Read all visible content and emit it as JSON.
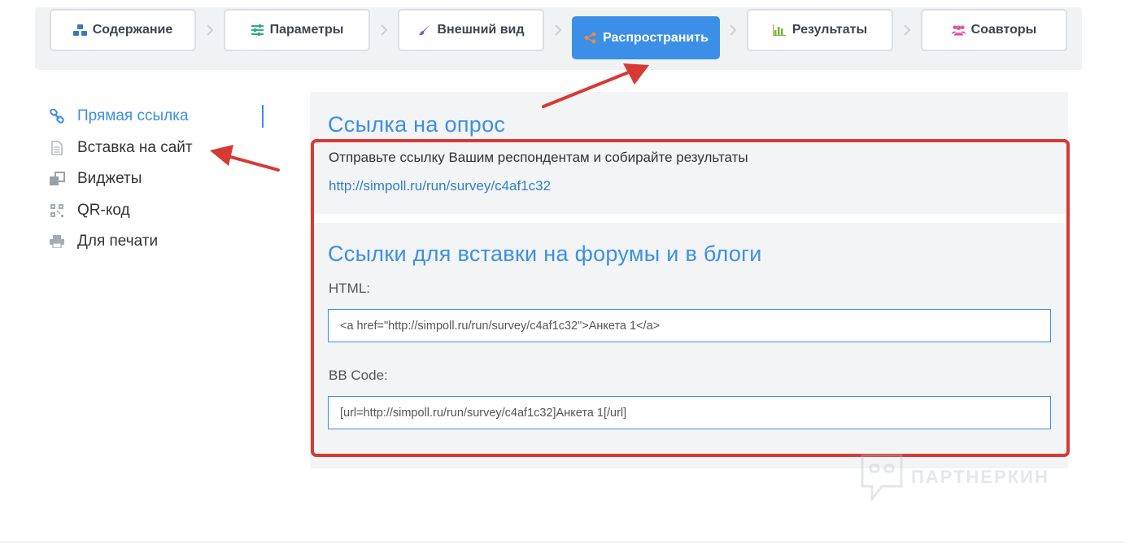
{
  "steps": [
    {
      "label": "Содержание",
      "icon": "cubes-icon"
    },
    {
      "label": "Параметры",
      "icon": "sliders-icon"
    },
    {
      "label": "Внешний вид",
      "icon": "brush-icon"
    },
    {
      "label": "Распространить",
      "icon": "share-icon",
      "active": true
    },
    {
      "label": "Результаты",
      "icon": "bar-chart-icon"
    },
    {
      "label": "Соавторы",
      "icon": "users-icon"
    }
  ],
  "sidebar": {
    "items": [
      {
        "label": "Прямая ссылка",
        "icon": "link-icon",
        "active": true
      },
      {
        "label": "Вставка на сайт",
        "icon": "document-icon"
      },
      {
        "label": "Виджеты",
        "icon": "widgets-icon"
      },
      {
        "label": "QR-код",
        "icon": "qr-code-icon"
      },
      {
        "label": "Для печати",
        "icon": "printer-icon"
      }
    ]
  },
  "main": {
    "survey_link": {
      "title": "Ссылка на опрос",
      "description": "Отправьте ссылку Вашим респондентам и собирайте результаты",
      "url": "http://simpoll.ru/run/survey/c4af1c32"
    },
    "embed": {
      "title": "Ссылки для вставки на форумы и в блоги",
      "html_label": "HTML:",
      "html_value": "<a href=\"http://simpoll.ru/run/survey/c4af1c32\">Анкета 1</a>",
      "bb_label": "BB Code:",
      "bb_value": "[url=http://simpoll.ru/run/survey/c4af1c32]Анкета 1[/url]"
    }
  },
  "watermark": {
    "text": "ПАРТНЕРКИН"
  },
  "colors": {
    "accent": "#3b8fe6",
    "annotation": "#d63a34",
    "panel_bg": "#f3f4f6"
  }
}
